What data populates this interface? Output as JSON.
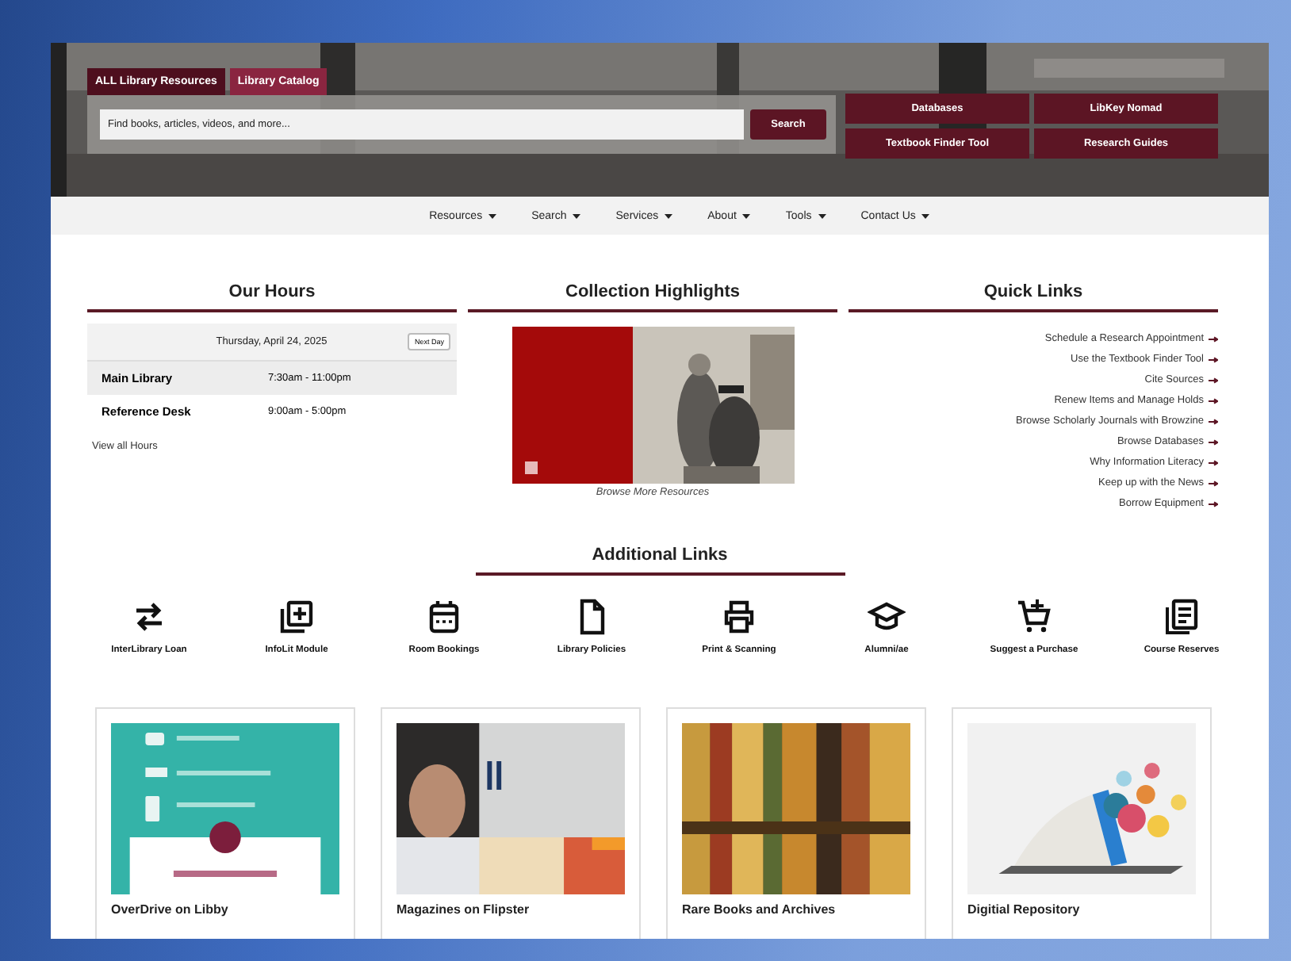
{
  "search_tabs": [
    {
      "label": "ALL Library Resources",
      "selected": true
    },
    {
      "label": "Library Catalog",
      "selected": false
    }
  ],
  "search": {
    "placeholder": "Find books, articles, videos, and more...",
    "button": "Search"
  },
  "quick_buttons": [
    "Databases",
    "LibKey Nomad",
    "Textbook Finder Tool",
    "Research Guides"
  ],
  "nav": [
    "Resources",
    "Search",
    "Services",
    "About",
    "Tools",
    "Contact Us"
  ],
  "hours": {
    "title": "Our Hours",
    "date": "Thursday, April 24, 2025",
    "next_button": "Next Day",
    "rows": [
      {
        "place": "Main Library",
        "time": "7:30am - 11:00pm"
      },
      {
        "place": "Reference Desk",
        "time": "9:00am - 5:00pm"
      }
    ],
    "link": "View all Hours"
  },
  "highlights": {
    "title": "Collection Highlights",
    "caption": "Browse More Resources"
  },
  "quick_links": {
    "title": "Quick Links",
    "items": [
      "Schedule a Research Appointment",
      "Use the Textbook Finder Tool",
      "Cite Sources",
      "Renew Items and Manage Holds",
      "Browse Scholarly Journals with Browzine",
      "Browse Databases",
      "Why Information Literacy",
      "Keep up with the News",
      "Borrow Equipment"
    ]
  },
  "additional_links": {
    "title": "Additional Links",
    "items": [
      "InterLibrary Loan",
      "InfoLit Module",
      "Room Bookings",
      "Library Policies",
      "Print & Scanning",
      "Alumni/ae",
      "Suggest a Purchase",
      "Course Reserves"
    ]
  },
  "cards": [
    {
      "title": "OverDrive on Libby"
    },
    {
      "title": "Magazines on Flipster"
    },
    {
      "title": "Rare Books and Archives"
    },
    {
      "title": "Digitial Repository"
    }
  ]
}
